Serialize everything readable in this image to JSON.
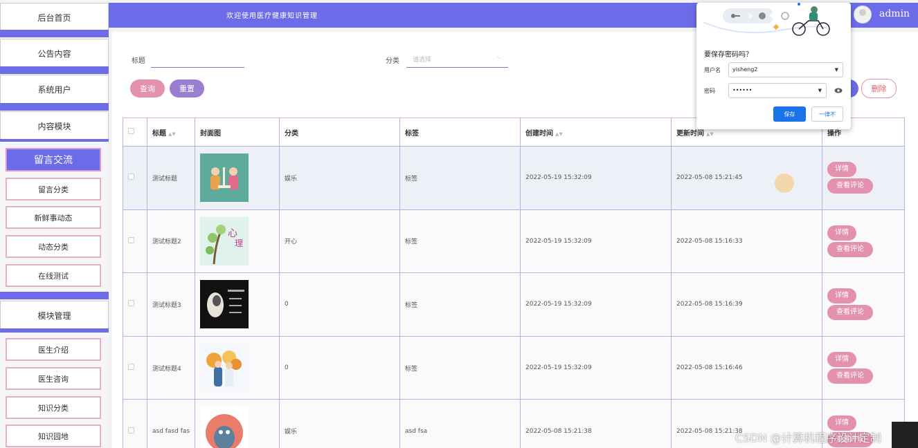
{
  "header": {
    "title": "欢迎使用医疗健康知识管理",
    "user": "admin"
  },
  "sidebar": {
    "menus": [
      "后台首页",
      "公告内容",
      "系统用户",
      "内容模块"
    ],
    "active": "留言交流",
    "sub_a": [
      "留言分类",
      "新鲜事动态",
      "动态分类",
      "在线测试"
    ],
    "module": "模块管理",
    "sub_b": [
      "医生介绍",
      "医生咨询",
      "知识分类",
      "知识园地"
    ]
  },
  "search": {
    "title_label": "标题",
    "category_label": "分类",
    "category_placeholder": "请选择",
    "query_button": "查询",
    "reset_button": "重置",
    "delete_button": "删除"
  },
  "table": {
    "headers": [
      "标题",
      "封面图",
      "分类",
      "标签",
      "创建时间",
      "更新时间",
      "操作"
    ],
    "detail_label": "详情",
    "comment_label": "查看评论",
    "rows": [
      {
        "title": "测试标题",
        "category": "娱乐",
        "tag": "标签",
        "created": "2022-05-19 15:32:09",
        "updated": "2022-05-08 15:21:45"
      },
      {
        "title": "测试标题2",
        "category": "开心",
        "tag": "标签",
        "created": "2022-05-19 15:32:09",
        "updated": "2022-05-08 15:16:33"
      },
      {
        "title": "测试标题3",
        "category": "0",
        "tag": "标签",
        "created": "2022-05-19 15:32:09",
        "updated": "2022-05-08 15:16:39"
      },
      {
        "title": "测试标题4",
        "category": "0",
        "tag": "标签",
        "created": "2022-05-19 15:32:09",
        "updated": "2022-05-08 15:16:46"
      },
      {
        "title": "asd fasd fas",
        "category": "娱乐",
        "tag": "asd fsa",
        "created": "2022-05-08 15:21:38",
        "updated": "2022-05-08 15:21:38"
      }
    ]
  },
  "password_popup": {
    "title": "要保存密码吗？",
    "username_label": "用户名",
    "username_value": "yisheng2",
    "password_label": "密码",
    "password_value": "••••••",
    "save_button": "保存",
    "never_button": "一律不"
  },
  "watermark": "CSDN @计算机程序设计定制",
  "colors": {
    "accent": "#6c6ce8",
    "pink_button": "#e391ae",
    "reset_button": "#9a7fd0",
    "save_blue": "#1a73e8"
  }
}
